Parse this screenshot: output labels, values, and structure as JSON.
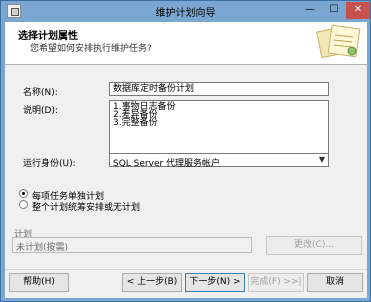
{
  "window": {
    "title": "维护计划向导",
    "min_label": "—",
    "max_label": "☐",
    "close_label": "✕"
  },
  "header": {
    "title": "选择计划属性",
    "subtitle": "您希望如何安排执行维护任务?"
  },
  "form": {
    "name_label": "名称(N):",
    "name_value": "数据库定时备份计划",
    "desc_label": "说明(D):",
    "desc_value": "1.事物日志备份\n2.差异备份\n3.完整备份",
    "runas_label": "运行身份(U):",
    "runas_value": "SQL Server 代理服务帐户"
  },
  "options": {
    "separate_label": "每项任务单独计划",
    "single_label": "整个计划统筹安排或无计划",
    "selected": "separate"
  },
  "schedule": {
    "label": "计划",
    "value": "未计划(按需)",
    "change_label": "更改(C)..."
  },
  "footer": {
    "help_label": "帮助(H)",
    "back_label": "< 上一步(B)",
    "next_label": "下一步(N) >",
    "finish_label": "完成(F) >>|",
    "cancel_label": "取消"
  }
}
